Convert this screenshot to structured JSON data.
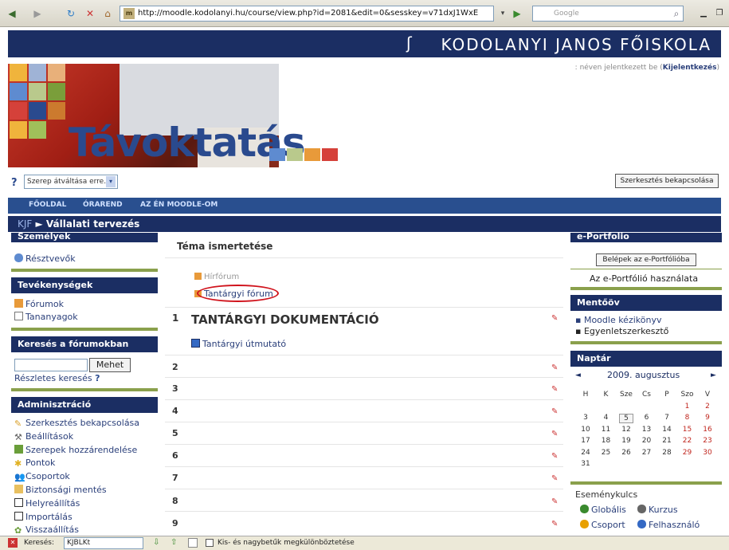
{
  "browser": {
    "url": "http://moodle.kodolanyi.hu/course/view.php?id=2081&edit=0&sesskey=v71dxJ1WxE",
    "search_placeholder": "Google",
    "favicon": "m"
  },
  "header": {
    "school_name": "KODOLANYI JANOS FŐISKOLA",
    "login_text": ": néven jelentkezett be (",
    "logout_label": "Kijelentkezés",
    "logout_close": ")",
    "brand": "Távoktatás",
    "role_select": "Szerep átváltása erre...",
    "edit_button": "Szerkesztés bekapcsolása"
  },
  "nav": {
    "items": [
      "FŐOLDAL",
      "ÓRAREND",
      "AZ ÉN MOODLE-OM"
    ]
  },
  "breadcrumb": {
    "root": "KJF",
    "sep": "►",
    "current": "Vállalati tervezés"
  },
  "left": {
    "people": {
      "title": "Személyek",
      "items": [
        "Résztvevők"
      ]
    },
    "activities": {
      "title": "Tevékenységek",
      "items": [
        "Fórumok",
        "Tananyagok"
      ]
    },
    "search": {
      "title": "Keresés a fórumokban",
      "button": "Mehet",
      "advanced": "Részletes keresés",
      "help": "?"
    },
    "admin": {
      "title": "Adminisztráció",
      "items": [
        "Szerkesztés bekapcsolása",
        "Beállítások",
        "Szerepek hozzárendelése",
        "Pontok",
        "Csoportok",
        "Biztonsági mentés",
        "Helyreállítás",
        "Importálás",
        "Visszaállítás"
      ]
    }
  },
  "center": {
    "topic_title": "Téma ismertetése",
    "news_forum": "Hírfórum",
    "course_forum": "Tantárgyi fórum",
    "section1_num": "1",
    "section1_title": "TANTÁRGYI DOKUMENTÁCIÓ",
    "guide": "Tantárgyi útmutató",
    "sections": [
      "2",
      "3",
      "4",
      "5",
      "6",
      "7",
      "8",
      "9"
    ]
  },
  "right": {
    "eportfolio": {
      "title": "e-Portfolio",
      "button": "Belépek az e-Portfólióba",
      "link": "Az e-Portfólió használata"
    },
    "backup": {
      "title": "Mentőöv",
      "items": [
        "Moodle kézikönyv",
        "Egyenletszerkesztő"
      ]
    },
    "calendar": {
      "title": "Naptár",
      "month": "2009. augusztus",
      "prev": "◄",
      "next": "►",
      "days": [
        "H",
        "K",
        "Sze",
        "Cs",
        "P",
        "Szo",
        "V"
      ],
      "weeks": [
        [
          "",
          "",
          "",
          "",
          "",
          "1",
          "2"
        ],
        [
          "3",
          "4",
          "5",
          "6",
          "7",
          "8",
          "9"
        ],
        [
          "10",
          "11",
          "12",
          "13",
          "14",
          "15",
          "16"
        ],
        [
          "17",
          "18",
          "19",
          "20",
          "21",
          "22",
          "23"
        ],
        [
          "24",
          "25",
          "26",
          "27",
          "28",
          "29",
          "30"
        ],
        [
          "31",
          "",
          "",
          "",
          "",
          "",
          ""
        ]
      ],
      "today": "5"
    },
    "events": {
      "title": "Eseménykulcs",
      "items": [
        "Globális",
        "Kurzus",
        "Csoport",
        "Felhasználó"
      ]
    }
  },
  "status": {
    "find_label": "Keresés:",
    "find_value": "KJBLKt",
    "case_label": "Kis- és nagybetűk megkülönböztetése"
  },
  "colors": {
    "navy": "#1b2e63",
    "accent_green": "#8aa04c",
    "link": "#2a3f7a",
    "highlight": "#d0121b"
  }
}
